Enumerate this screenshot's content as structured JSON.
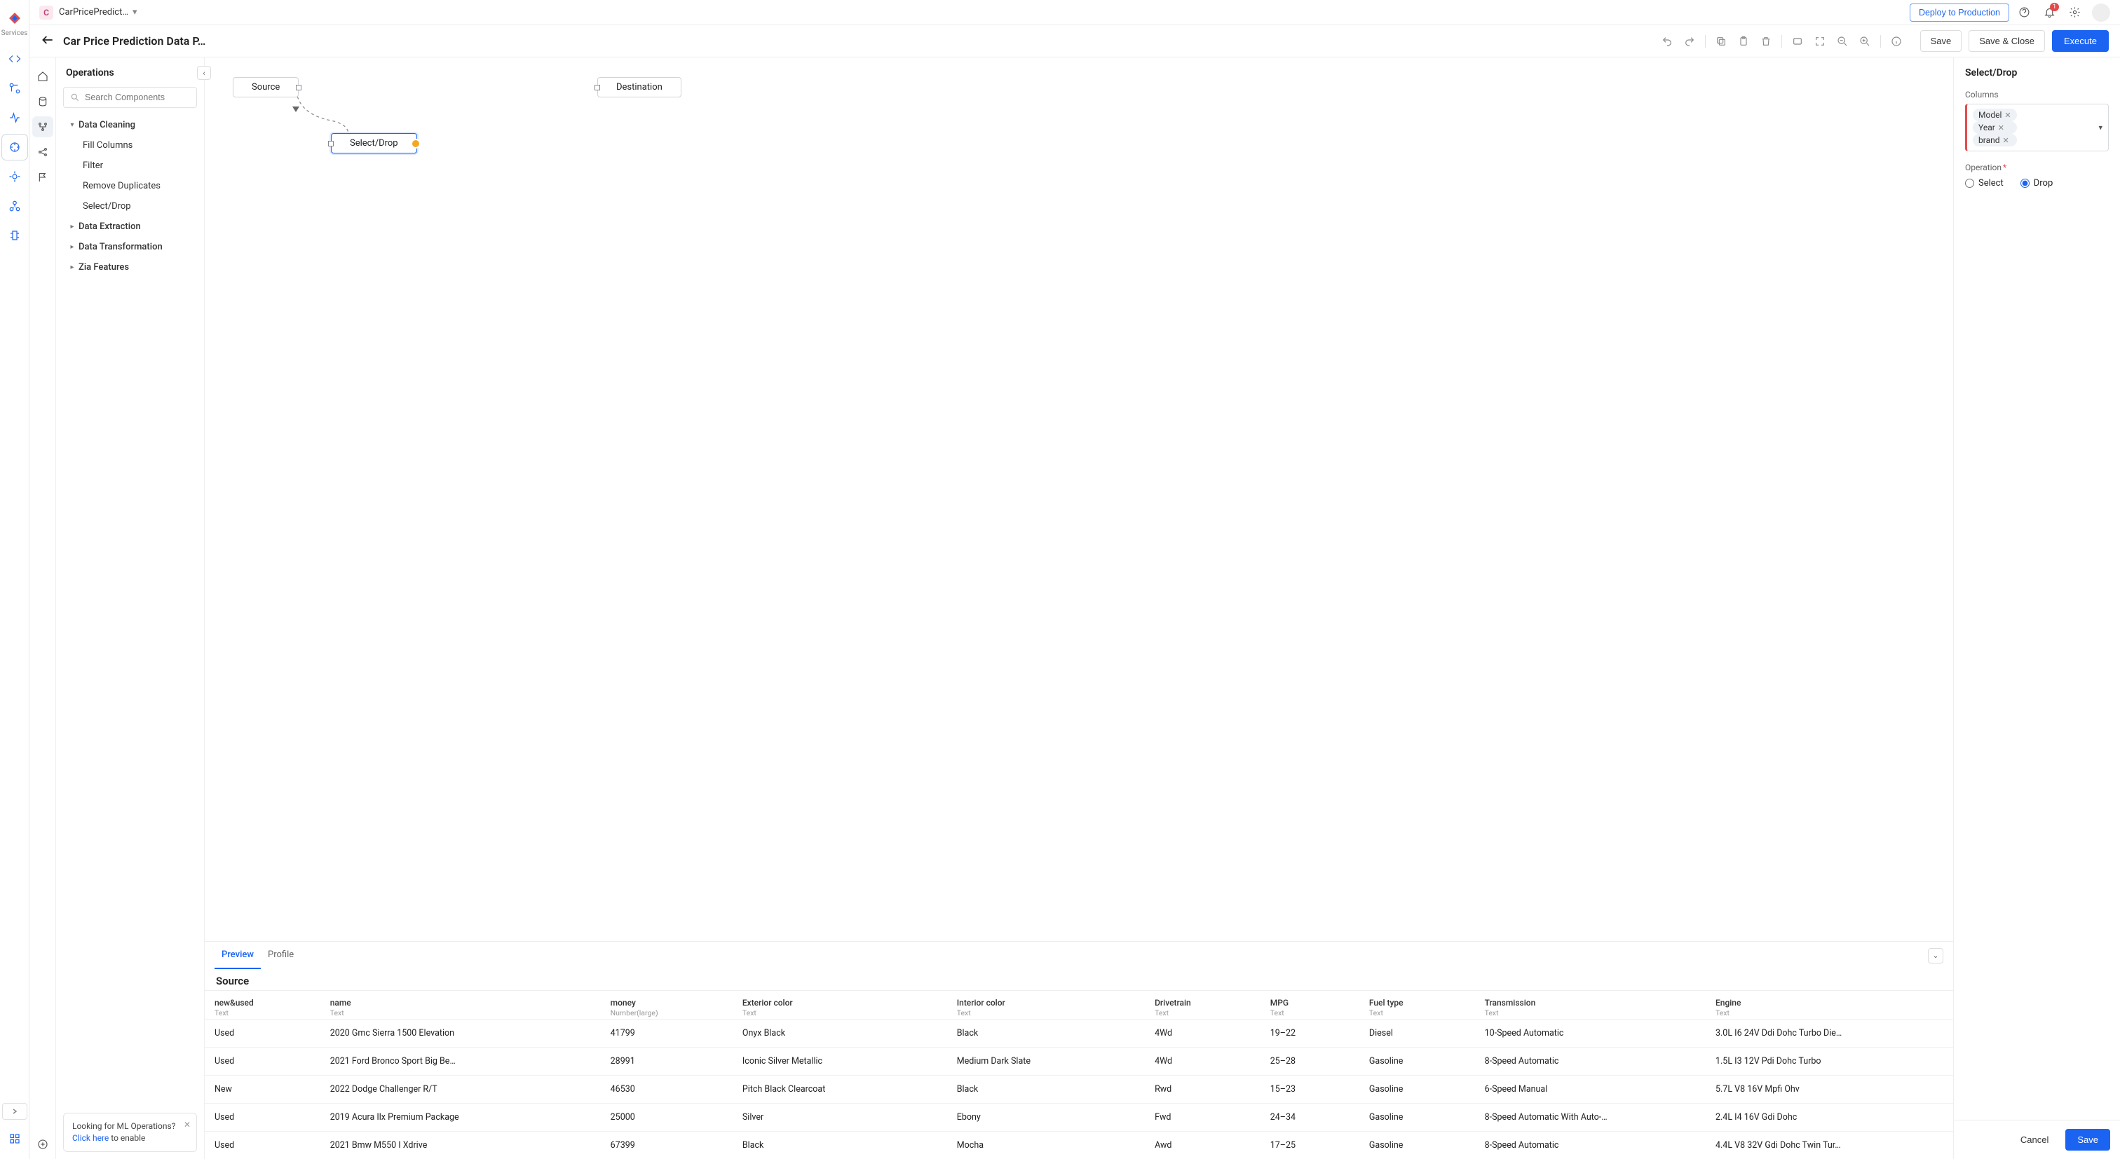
{
  "rail": {
    "services_label": "Services"
  },
  "topbar": {
    "workspace_initial": "C",
    "workspace_name": "CarPricePredict…",
    "deploy_label": "Deploy to Production",
    "notification_count": "1"
  },
  "toolbar": {
    "page_title": "Car Price Prediction Data P…",
    "save_label": "Save",
    "save_close_label": "Save & Close",
    "execute_label": "Execute"
  },
  "ops": {
    "title": "Operations",
    "search_placeholder": "Search Components",
    "groups": {
      "data_cleaning": "Data Cleaning",
      "data_extraction": "Data Extraction",
      "data_transformation": "Data Transformation",
      "zia_features": "Zia Features"
    },
    "data_cleaning_items": {
      "fill_columns": "Fill Columns",
      "filter": "Filter",
      "remove_duplicates": "Remove Duplicates",
      "select_drop": "Select/Drop"
    },
    "ml_tip_q": "Looking for ML Operations?",
    "ml_tip_link": "Click here",
    "ml_tip_rest": " to enable"
  },
  "canvas": {
    "source_label": "Source",
    "select_drop_label": "Select/Drop",
    "destination_label": "Destination"
  },
  "bottom": {
    "tabs": {
      "preview": "Preview",
      "profile": "Profile"
    },
    "source_title": "Source",
    "columns": [
      {
        "name": "new&used",
        "type": "Text"
      },
      {
        "name": "name",
        "type": "Text"
      },
      {
        "name": "money",
        "type": "Number(large)"
      },
      {
        "name": "Exterior color",
        "type": "Text"
      },
      {
        "name": "Interior color",
        "type": "Text"
      },
      {
        "name": "Drivetrain",
        "type": "Text"
      },
      {
        "name": "MPG",
        "type": "Text"
      },
      {
        "name": "Fuel type",
        "type": "Text"
      },
      {
        "name": "Transmission",
        "type": "Text"
      },
      {
        "name": "Engine",
        "type": "Text"
      }
    ],
    "rows": [
      [
        "Used",
        "2020 Gmc Sierra 1500 Elevation",
        "41799",
        "Onyx Black",
        "Black",
        "4Wd",
        "19–22",
        "Diesel",
        "10-Speed Automatic",
        "3.0L I6 24V Ddi Dohc Turbo Die…"
      ],
      [
        "Used",
        "2021 Ford Bronco Sport Big Be…",
        "28991",
        "Iconic Silver Metallic",
        "Medium Dark Slate",
        "4Wd",
        "25–28",
        "Gasoline",
        "8-Speed Automatic",
        "1.5L I3 12V Pdi Dohc Turbo"
      ],
      [
        "New",
        "2022 Dodge Challenger R/T",
        "46530",
        "Pitch Black Clearcoat",
        "Black",
        "Rwd",
        "15–23",
        "Gasoline",
        "6-Speed Manual",
        "5.7L V8 16V Mpfi Ohv"
      ],
      [
        "Used",
        "2019 Acura Ilx Premium Package",
        "25000",
        "Silver",
        "Ebony",
        "Fwd",
        "24–34",
        "Gasoline",
        "8-Speed Automatic With Auto-…",
        "2.4L I4 16V Gdi Dohc"
      ],
      [
        "Used",
        "2021 Bmw M550 I Xdrive",
        "67399",
        "Black",
        "Mocha",
        "Awd",
        "17–25",
        "Gasoline",
        "8-Speed Automatic",
        "4.4L V8 32V Gdi Dohc Twin Tur…"
      ]
    ]
  },
  "config": {
    "title": "Select/Drop",
    "columns_label": "Columns",
    "chips": [
      "Model",
      "Year",
      "brand"
    ],
    "operation_label": "Operation",
    "radio_select": "Select",
    "radio_drop": "Drop",
    "selected_operation": "Drop",
    "cancel_label": "Cancel",
    "save_label": "Save"
  }
}
